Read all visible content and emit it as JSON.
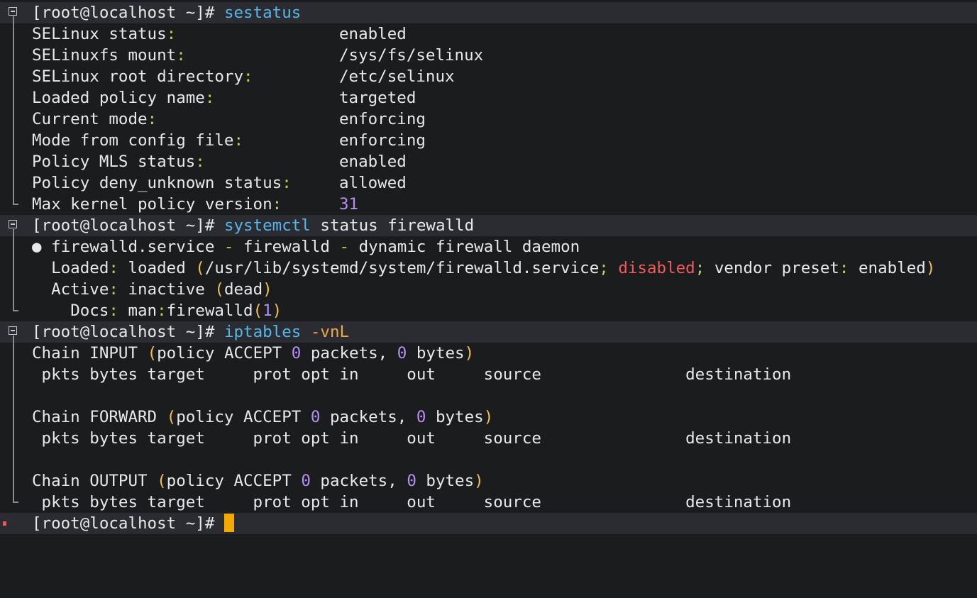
{
  "prompt": "[root@localhost ~]#",
  "commands": {
    "sestatus": "sestatus",
    "systemctl": "systemctl",
    "systemctl_args": "status firewalld",
    "iptables": "iptables",
    "iptables_args": "-vnL"
  },
  "sestatus": [
    {
      "key": "SELinux status",
      "value": "enabled"
    },
    {
      "key": "SELinuxfs mount",
      "value": "/sys/fs/selinux"
    },
    {
      "key": "SELinux root directory",
      "value": "/etc/selinux"
    },
    {
      "key": "Loaded policy name",
      "value": "targeted"
    },
    {
      "key": "Current mode",
      "value": "enforcing"
    },
    {
      "key": "Mode from config file",
      "value": "enforcing"
    },
    {
      "key": "Policy MLS status",
      "value": "enabled"
    },
    {
      "key": "Policy deny_unknown status",
      "value": "allowed"
    },
    {
      "key": "Max kernel policy version",
      "value": "31"
    }
  ],
  "firewalld": {
    "bullet": "●",
    "service": "firewalld.service",
    "dash": " - ",
    "name": "firewalld",
    "desc": "dynamic firewall daemon",
    "loaded_label": "Loaded",
    "loaded_state": "loaded",
    "unit_path": "/usr/lib/systemd/system/firewalld.service",
    "enabled_state": "disabled",
    "vendor_label": "vendor preset",
    "vendor_value": "enabled",
    "active_label": "Active",
    "active_state": "inactive",
    "active_sub": "dead",
    "docs_label": "Docs",
    "docs_man": "man",
    "docs_page": "firewalld",
    "docs_section": "1"
  },
  "iptables": {
    "chains": [
      {
        "name": "INPUT",
        "policy": "ACCEPT",
        "packets": "0",
        "bytes": "0"
      },
      {
        "name": "FORWARD",
        "policy": "ACCEPT",
        "packets": "0",
        "bytes": "0"
      },
      {
        "name": "OUTPUT",
        "policy": "ACCEPT",
        "packets": "0",
        "bytes": "0"
      }
    ],
    "chain_word": "Chain",
    "policy_word": "policy",
    "packets_word": "packets,",
    "bytes_word": "bytes",
    "header": " pkts bytes target     prot opt in     out     source               destination"
  },
  "colors": {
    "background": "#1b1c1e",
    "highlight_line": "#2a2c31",
    "command": "#55b6e8",
    "argument": "#f0a742",
    "number": "#b48ef0",
    "error": "#ef5a5a",
    "cursor": "#f5a800"
  },
  "icons": [
    "fold-collapse-icon",
    "fold-line-icon",
    "cursor-block"
  ]
}
